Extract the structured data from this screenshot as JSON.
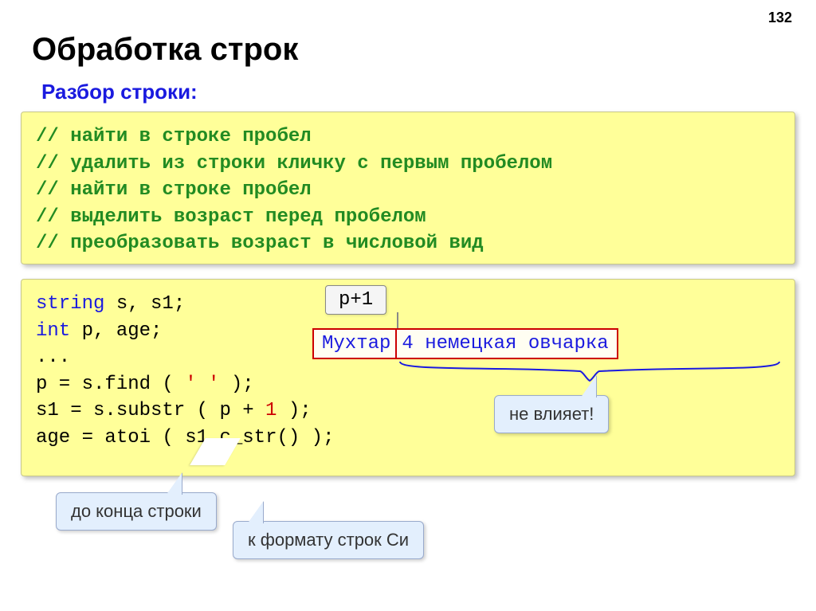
{
  "page_number": "132",
  "title": "Обработка строк",
  "subtitle": "Разбор строки:",
  "comments": {
    "c1": "// найти в строке пробел",
    "c2": "// удалить из строки кличку с первым пробелом",
    "c3": "// найти в строке пробел",
    "c4": "// выделить возраст перед пробелом",
    "c5": "// преобразовать возраст в числовой вид"
  },
  "code": {
    "kw_string": "string",
    "decl_string_rest": " s, s1;",
    "kw_int": "int",
    "decl_int_rest": " p, age;",
    "ellipsis": "...",
    "find_pre": "p = s.find ( ",
    "find_lit": "' '",
    "find_post": " );",
    "substr_pre": "s1 = s.substr ( p + ",
    "substr_lit": "1",
    "substr_post": " );",
    "atoi_pre": "age = atoi ( s1",
    "atoi_mid": ".c",
    "atoi_post": "_str() );"
  },
  "pointer_label": "p+1",
  "example_string": {
    "left": "Мухтар",
    "right": "4 немецкая овчарка"
  },
  "bubbles": {
    "not_affect": "не влияет!",
    "to_end": "до конца строки",
    "c_format": "к формату строк Си"
  }
}
